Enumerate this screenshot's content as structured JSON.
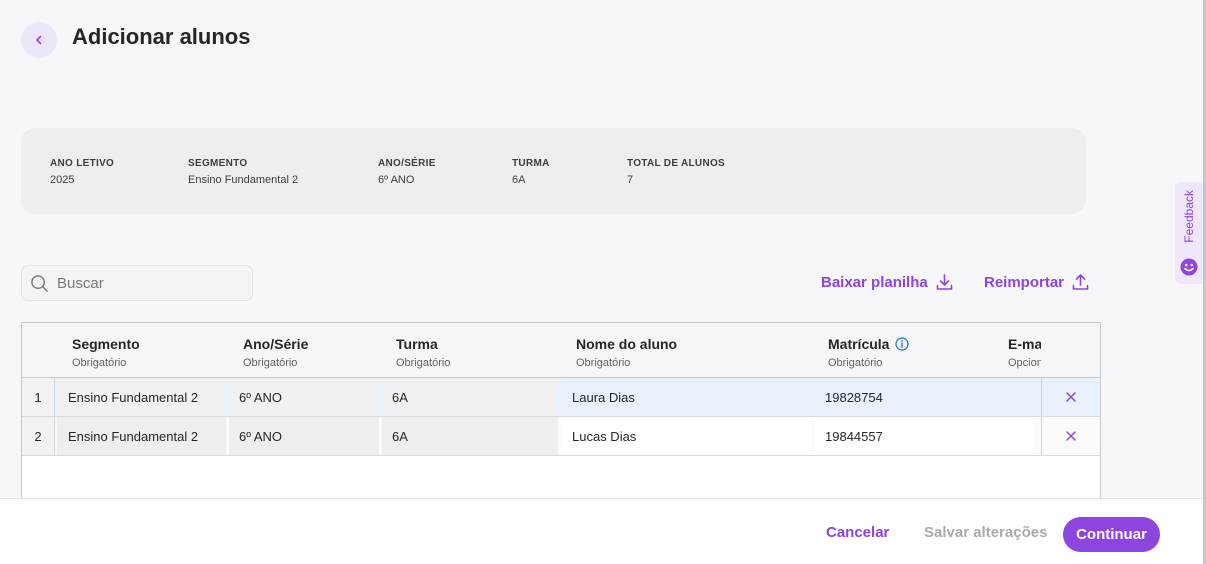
{
  "header": {
    "title": "Adicionar alunos",
    "back_icon": "chevron-left-icon"
  },
  "summary": [
    {
      "label": "ANO LETIVO",
      "value": "2025"
    },
    {
      "label": "SEGMENTO",
      "value": "Ensino Fundamental 2"
    },
    {
      "label": "ANO/SÉRIE",
      "value": "6º ANO"
    },
    {
      "label": "TURMA",
      "value": "6A"
    },
    {
      "label": "TOTAL DE ALUNOS",
      "value": "7"
    }
  ],
  "search": {
    "placeholder": "Buscar",
    "value": ""
  },
  "actions": {
    "download_label": "Baixar planilha",
    "reimport_label": "Reimportar"
  },
  "feedback": {
    "label": "Feedback"
  },
  "table": {
    "columns": [
      {
        "title": "Segmento",
        "sub": "Obrigatório"
      },
      {
        "title": "Ano/Série",
        "sub": "Obrigatório"
      },
      {
        "title": "Turma",
        "sub": "Obrigatório"
      },
      {
        "title": "Nome do aluno",
        "sub": "Obrigatório"
      },
      {
        "title": "Matrícula",
        "sub": "Obrigatório"
      },
      {
        "title": "E-mai",
        "sub": "Opcion"
      }
    ],
    "rows": [
      {
        "num": "1",
        "segmento": "Ensino Fundamental 2",
        "ano": "6º ANO",
        "turma": "6A",
        "nome": "Laura Dias",
        "matricula": "19828754"
      },
      {
        "num": "2",
        "segmento": "Ensino Fundamental 2",
        "ano": "6º ANO",
        "turma": "6A",
        "nome": "Lucas Dias",
        "matricula": "19844557"
      }
    ]
  },
  "footer": {
    "cancel_label": "Cancelar",
    "save_label": "Salvar alterações",
    "continue_label": "Continuar"
  },
  "colors": {
    "accent": "#8E44DF",
    "selected_row": "#E8F2FC",
    "disabled_text": "#A9AAB0"
  }
}
